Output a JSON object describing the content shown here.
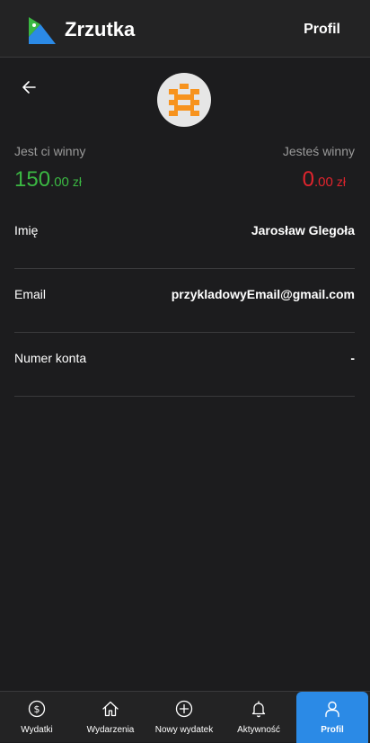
{
  "header": {
    "app_title": "Zrzutka",
    "profile_link": "Profil"
  },
  "balances": {
    "owed_to_you": {
      "label": "Jest ci winny",
      "main": "150",
      "decimals": ".00",
      "currency": "zł"
    },
    "you_owe": {
      "label": "Jesteś winny",
      "main": "0",
      "decimals": ".00",
      "currency": "zł"
    }
  },
  "profile_rows": [
    {
      "label": "Imię",
      "value": "Jarosław Glegoła"
    },
    {
      "label": "Email",
      "value": "przykladowyEmail@gmail.com"
    },
    {
      "label": "Numer konta",
      "value": "-"
    }
  ],
  "nav": [
    {
      "label": "Wydatki",
      "icon": "dollar-icon"
    },
    {
      "label": "Wydarzenia",
      "icon": "home-icon"
    },
    {
      "label": "Nowy wydatek",
      "icon": "plus-circle-icon"
    },
    {
      "label": "Aktywność",
      "icon": "bell-icon"
    },
    {
      "label": "Profil",
      "icon": "user-icon",
      "active": true
    }
  ],
  "colors": {
    "positive": "#3bb843",
    "negative": "#e0242d",
    "active_nav": "#2b8ae6",
    "avatar_accent": "#f7931e"
  }
}
